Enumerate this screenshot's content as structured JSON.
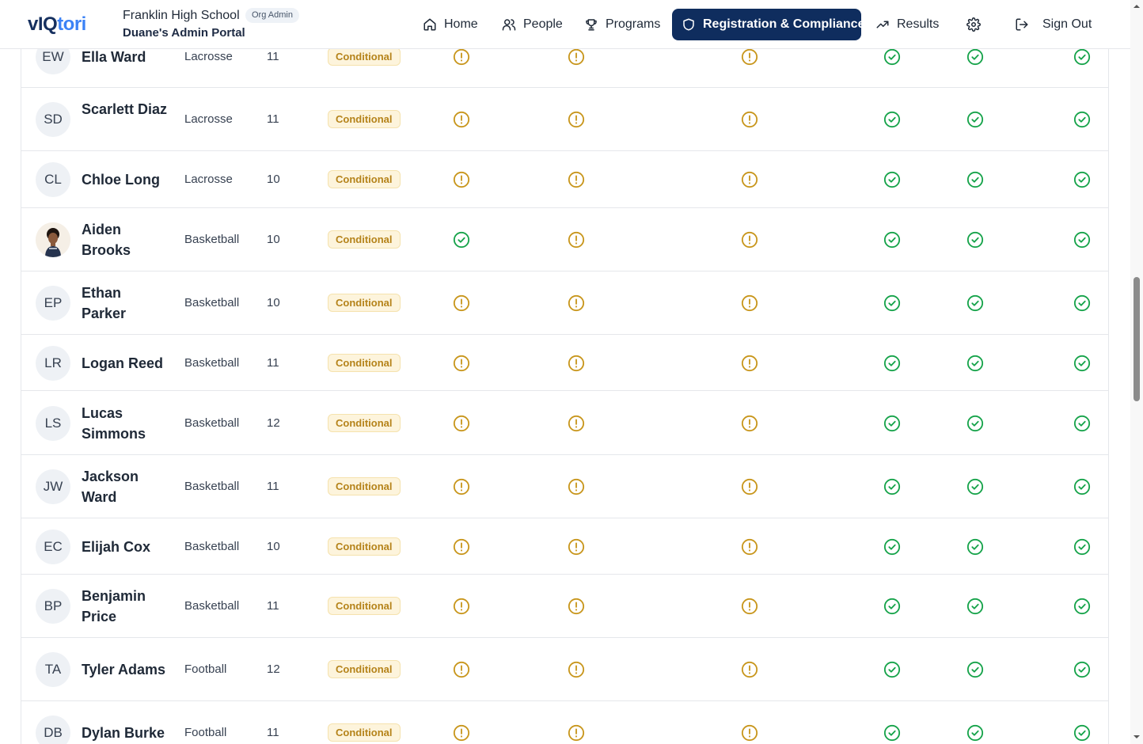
{
  "header": {
    "logo_part1": "vIQ",
    "logo_part2": "tori",
    "org_name": "Franklin High School",
    "org_role_badge": "Org Admin",
    "portal_name": "Duane's Admin Portal"
  },
  "nav": {
    "home": "Home",
    "people": "People",
    "programs": "Programs",
    "registration": "Registration & Compliance",
    "results": "Results",
    "settings_icon": "gear-icon",
    "sign_out": "Sign Out"
  },
  "colors": {
    "accent": "#0f2d5e",
    "warning": "#c8961c",
    "success": "#16a34a",
    "badge_bg": "#fdf4dc"
  },
  "rows": [
    {
      "initials": "EW",
      "name": "Ella Ward",
      "sport": "Lacrosse",
      "grade": "11",
      "status": "Conditional",
      "checks": [
        "warning",
        "warning",
        "warning",
        "ok",
        "ok",
        "ok"
      ]
    },
    {
      "initials": "SD",
      "name": "Scarlett Diaz",
      "sport": "Lacrosse",
      "grade": "11",
      "status": "Conditional",
      "checks": [
        "warning",
        "warning",
        "warning",
        "ok",
        "ok",
        "ok"
      ]
    },
    {
      "initials": "CL",
      "name": "Chloe Long",
      "sport": "Lacrosse",
      "grade": "10",
      "status": "Conditional",
      "checks": [
        "warning",
        "warning",
        "warning",
        "ok",
        "ok",
        "ok"
      ]
    },
    {
      "initials": "",
      "name": "Aiden Brooks",
      "sport": "Basketball",
      "grade": "10",
      "status": "Conditional",
      "checks": [
        "ok",
        "warning",
        "warning",
        "ok",
        "ok",
        "ok"
      ],
      "photo": true
    },
    {
      "initials": "EP",
      "name": "Ethan Parker",
      "sport": "Basketball",
      "grade": "10",
      "status": "Conditional",
      "checks": [
        "warning",
        "warning",
        "warning",
        "ok",
        "ok",
        "ok"
      ]
    },
    {
      "initials": "LR",
      "name": "Logan Reed",
      "sport": "Basketball",
      "grade": "11",
      "status": "Conditional",
      "checks": [
        "warning",
        "warning",
        "warning",
        "ok",
        "ok",
        "ok"
      ]
    },
    {
      "initials": "LS",
      "name": "Lucas Simmons",
      "sport": "Basketball",
      "grade": "12",
      "status": "Conditional",
      "checks": [
        "warning",
        "warning",
        "warning",
        "ok",
        "ok",
        "ok"
      ]
    },
    {
      "initials": "JW",
      "name": "Jackson Ward",
      "sport": "Basketball",
      "grade": "11",
      "status": "Conditional",
      "checks": [
        "warning",
        "warning",
        "warning",
        "ok",
        "ok",
        "ok"
      ]
    },
    {
      "initials": "EC",
      "name": "Elijah Cox",
      "sport": "Basketball",
      "grade": "10",
      "status": "Conditional",
      "checks": [
        "warning",
        "warning",
        "warning",
        "ok",
        "ok",
        "ok"
      ]
    },
    {
      "initials": "BP",
      "name": "Benjamin Price",
      "sport": "Basketball",
      "grade": "11",
      "status": "Conditional",
      "checks": [
        "warning",
        "warning",
        "warning",
        "ok",
        "ok",
        "ok"
      ]
    },
    {
      "initials": "TA",
      "name": "Tyler Adams",
      "sport": "Football",
      "grade": "12",
      "status": "Conditional",
      "checks": [
        "warning",
        "warning",
        "warning",
        "ok",
        "ok",
        "ok"
      ]
    },
    {
      "initials": "DB",
      "name": "Dylan Burke",
      "sport": "Football",
      "grade": "11",
      "status": "Conditional",
      "checks": [
        "warning",
        "warning",
        "warning",
        "ok",
        "ok",
        "ok"
      ]
    }
  ]
}
